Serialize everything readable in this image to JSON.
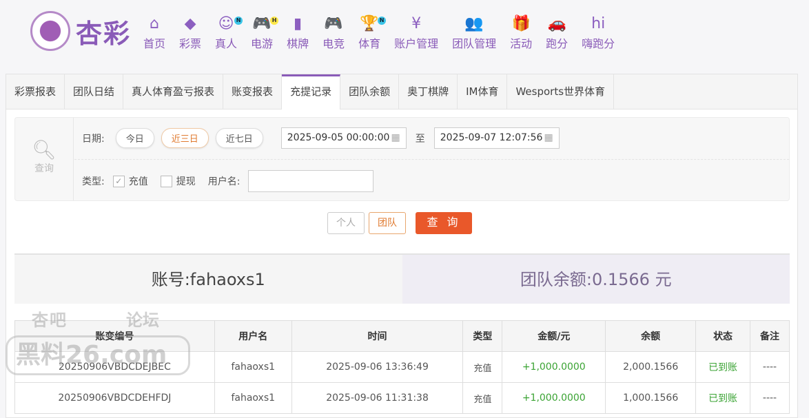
{
  "brand": {
    "name": "杏彩"
  },
  "nav": [
    {
      "label": "首页",
      "icon": "home-icon",
      "glyph": "⌂"
    },
    {
      "label": "彩票",
      "icon": "ticket-icon",
      "glyph": "◆"
    },
    {
      "label": "真人",
      "icon": "live-dealer-icon",
      "glyph": "☺",
      "badge": "N"
    },
    {
      "label": "电游",
      "icon": "gamepad-icon",
      "glyph": "🎮",
      "badge": "H"
    },
    {
      "label": "棋牌",
      "icon": "cards-icon",
      "glyph": "▮"
    },
    {
      "label": "电竞",
      "icon": "gamepad-icon",
      "glyph": "🎮"
    },
    {
      "label": "体育",
      "icon": "trophy-icon",
      "glyph": "🏆",
      "badge": "N"
    },
    {
      "label": "账户管理",
      "icon": "yen-icon",
      "glyph": "¥"
    },
    {
      "label": "团队管理",
      "icon": "team-icon",
      "glyph": "👥"
    },
    {
      "label": "活动",
      "icon": "gift-icon",
      "glyph": "🎁"
    },
    {
      "label": "跑分",
      "icon": "car-icon",
      "glyph": "🚗"
    },
    {
      "label": "嗨跑分",
      "icon": "hi-icon",
      "glyph": "hi"
    }
  ],
  "tabs": [
    "彩票报表",
    "团队日结",
    "真人体育盈亏报表",
    "账变报表",
    "充提记录",
    "团队余额",
    "奥丁棋牌",
    "IM体育",
    "Wesports世界体育"
  ],
  "active_tab": "充提记录",
  "filter": {
    "query_label": "查询",
    "date_label": "日期:",
    "quick": [
      "今日",
      "近三日",
      "近七日"
    ],
    "quick_selected": "近三日",
    "start": "2025-09-05 00:00:00",
    "to": "至",
    "end": "2025-09-07 12:07:56",
    "type_label": "类型:",
    "types": [
      {
        "label": "充值",
        "checked": true
      },
      {
        "label": "提现",
        "checked": false
      }
    ],
    "username_label": "用户名:",
    "username_value": ""
  },
  "buttons": {
    "personal": "个人",
    "team": "团队",
    "search": "查 询"
  },
  "account": {
    "label": "账号:fahaoxs1",
    "balance": "团队余额:0.1566 元"
  },
  "table": {
    "headers": [
      "账变编号",
      "用户名",
      "时间",
      "类型",
      "金额/元",
      "余额",
      "状态",
      "备注"
    ],
    "rows": [
      [
        "20250906VBDCDEJBEC",
        "fahaoxs1",
        "2025-09-06 13:36:49",
        "充值",
        "+1,000.0000",
        "2,000.1566",
        "已到账",
        "----"
      ],
      [
        "20250906VBDCDEHFDJ",
        "fahaoxs1",
        "2025-09-06 11:31:38",
        "充值",
        "+1,000.0000",
        "1,000.1566",
        "已到账",
        "----"
      ]
    ]
  },
  "watermark": {
    "line1a": "杏吧",
    "line1b": "论坛",
    "line2": "黑料26.com"
  },
  "colors": {
    "brand": "#8a5bb8",
    "accent": "#e9582a",
    "success": "#3aa333"
  }
}
